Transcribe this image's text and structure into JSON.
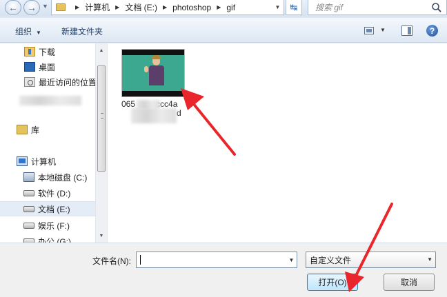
{
  "address_bar": {
    "breadcrumbs": [
      "计算机",
      "文档 (E:)",
      "photoshop",
      "gif"
    ],
    "search_placeholder": "搜索 gif"
  },
  "toolbar": {
    "organize_label": "组织",
    "new_folder_label": "新建文件夹"
  },
  "nav_pane": {
    "items": [
      {
        "label": "下载",
        "icon": "download-folder-icon"
      },
      {
        "label": "桌面",
        "icon": "desktop-icon"
      },
      {
        "label": "最近访问的位置",
        "icon": "recent-places-icon"
      },
      {
        "label": "库",
        "icon": "library-icon"
      },
      {
        "label": "计算机",
        "icon": "computer-icon"
      },
      {
        "label": "本地磁盘 (C:)",
        "icon": "system-drive-icon"
      },
      {
        "label": "软件 (D:)",
        "icon": "drive-icon"
      },
      {
        "label": "文档 (E:)",
        "icon": "drive-icon",
        "selected": true
      },
      {
        "label": "娱乐 (F:)",
        "icon": "drive-icon"
      },
      {
        "label": "办公 (G:)",
        "icon": "drive-icon"
      }
    ]
  },
  "file_area": {
    "files": [
      {
        "name_start": "065",
        "name_mid": "ccc4a",
        "name_end": "d"
      }
    ]
  },
  "bottom": {
    "filename_label": "文件名(N):",
    "filename_value": "",
    "filter_value": "自定义文件",
    "open_label": "打开(O)",
    "cancel_label": "取消"
  },
  "colors": {
    "annotation_arrow": "#e8262b",
    "window_background": "#dfe8f3",
    "selected_item": "#e3ecf7"
  }
}
